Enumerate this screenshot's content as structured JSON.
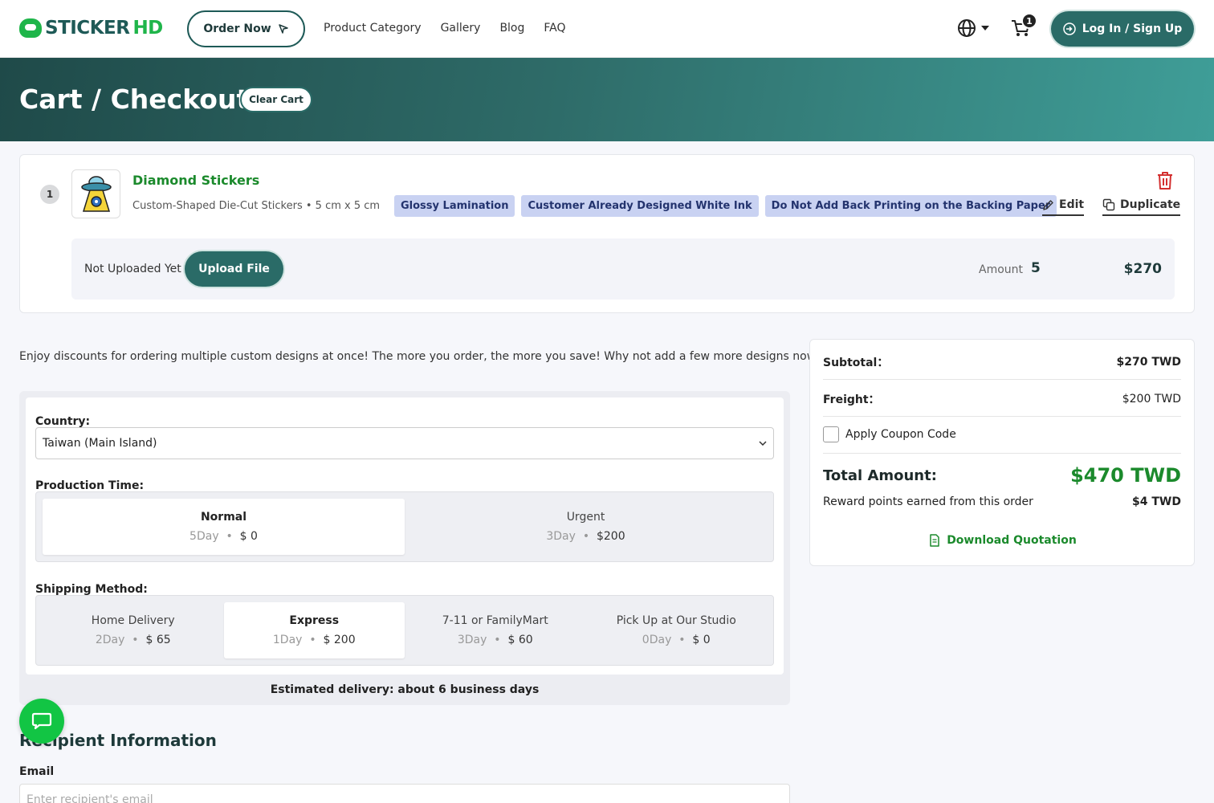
{
  "header": {
    "logo": {
      "part1": "STICKER",
      "part2": "HD"
    },
    "order_now": "Order Now",
    "nav": [
      "Product Category",
      "Gallery",
      "Blog",
      "FAQ"
    ],
    "cart_count": "1",
    "login": "Log In / Sign Up"
  },
  "banner": {
    "title": "Cart / Checkout",
    "clear_cart": "Clear Cart"
  },
  "item": {
    "index": "1",
    "name": "Diamond Stickers",
    "spec": "Custom-Shaped Die-Cut Stickers • 5 cm x 5 cm",
    "tags": [
      "Glossy Lamination",
      "Customer Already Designed White Ink",
      "Do Not Add Back Printing on the Backing Paper"
    ],
    "edit": "Edit",
    "duplicate": "Duplicate",
    "upload_status": "Not Uploaded Yet",
    "upload_button": "Upload File",
    "amount_label": "Amount",
    "amount": "5",
    "price": "$270"
  },
  "promo_text": "Enjoy discounts for ordering multiple custom designs at once! The more you order, the more you save! Why not add a few more designs now?",
  "shipping": {
    "country_label": "Country:",
    "country_value": "Taiwan (Main Island)",
    "production_label": "Production Time:",
    "production_options": [
      {
        "name": "Normal",
        "days": "5Day",
        "cost": "$ 0"
      },
      {
        "name": "Urgent",
        "days": "3Day",
        "cost": "$200"
      }
    ],
    "method_label": "Shipping Method:",
    "method_options": [
      {
        "name": "Home Delivery",
        "days": "2Day",
        "cost": "$ 65"
      },
      {
        "name": "Express",
        "days": "1Day",
        "cost": "$ 200"
      },
      {
        "name": "7-11 or FamilyMart",
        "days": "3Day",
        "cost": "$ 60"
      },
      {
        "name": "Pick Up at Our Studio",
        "days": "0Day",
        "cost": "$ 0"
      }
    ],
    "estimate": "Estimated delivery: about 6 business days"
  },
  "summary": {
    "subtotal_label": "Subtotal：",
    "subtotal": "$270 TWD",
    "freight_label": "Freight：",
    "freight": "$200 TWD",
    "coupon_label": "Apply Coupon Code",
    "total_label": "Total Amount:",
    "total": "$470 TWD",
    "reward_label": "Reward points earned from this order",
    "reward": "$4 TWD",
    "download": "Download Quotation"
  },
  "recipient": {
    "title": "Recipient Information",
    "email_label": "Email",
    "email_placeholder": "Enter recipient's email"
  },
  "colors": {
    "brand_green": "#1fb54a",
    "brand_teal": "#2a6b67",
    "tag_bg": "#c9d2f2",
    "danger": "#d32f2f"
  }
}
